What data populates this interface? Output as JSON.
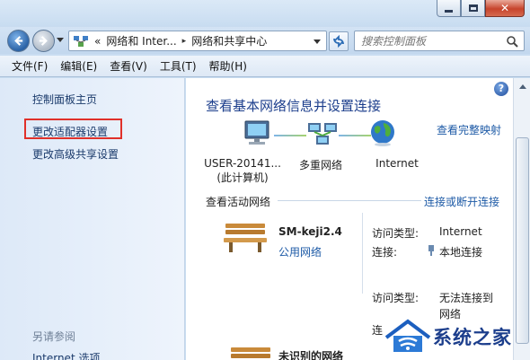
{
  "window": {
    "buttons": {
      "minimize": "minimize-icon",
      "maximize": "maximize-icon",
      "close": "close-icon",
      "close_glyph": "✕"
    }
  },
  "nav": {
    "address_breadcrumbs": [
      "«",
      "网络和 Inter...",
      "网络和共享中心"
    ],
    "breadcrumb_separator": "▸",
    "search_placeholder": "搜索控制面板"
  },
  "menu": [
    "文件(F)",
    "编辑(E)",
    "查看(V)",
    "工具(T)",
    "帮助(H)"
  ],
  "left_pane": {
    "items": [
      "控制面板主页",
      "更改适配器设置",
      "更改高级共享设置"
    ],
    "highlighted_item": "更改适配器设置",
    "see_also_title": "另请参阅",
    "see_also_items": [
      "Internet 选项"
    ]
  },
  "main": {
    "heading": "查看基本网络信息并设置连接",
    "help_glyph": "?",
    "map_link": "查看完整映射",
    "diagram": {
      "nodes": [
        {
          "label": "USER-20141...",
          "sublabel": "(此计算机)",
          "icon": "computer-icon"
        },
        {
          "label": "多重网络",
          "icon": "multiple-networks-icon"
        },
        {
          "label": "Internet",
          "icon": "globe-icon"
        }
      ]
    },
    "active_networks_title": "查看活动网络",
    "active_networks_link": "连接或断开连接",
    "networks": [
      {
        "name": "SM-keji2.4",
        "type": "公用网络",
        "icon": "park-bench-icon",
        "access_type_key": "访问类型:",
        "access_type_value": "Internet",
        "connection_key": "连接:",
        "connection_value": "本地连接"
      },
      {
        "access_type_key": "访问类型:",
        "access_type_value_line1": "无法连接到",
        "access_type_value_line2": "网络",
        "connection_key_partial": "连"
      },
      {
        "name": "未识别的网络",
        "icon": "park-bench-icon"
      }
    ]
  },
  "watermark": {
    "text": "系统之家",
    "logo": "house-logo"
  },
  "colors": {
    "link": "#1d5aa6",
    "heading": "#1c3e8c",
    "highlight_box": "#e0302a"
  }
}
